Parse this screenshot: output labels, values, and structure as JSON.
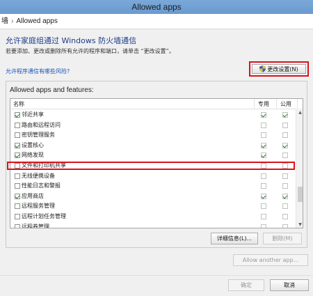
{
  "window": {
    "title": "Allowed apps"
  },
  "breadcrumb": {
    "prefix": "墙",
    "separator": "›",
    "current": "Allowed apps"
  },
  "header": {
    "title": "允许家庭组通过 Windows 防火墙通信",
    "description": "若要添加、更改或删除所有允许的程序和端口，请单击 “更改设置”。",
    "risk_link": "允许程序通信有哪些风险?",
    "change_settings_label": "更改设置(N)"
  },
  "list": {
    "group_label": "Allowed apps and features:",
    "columns": {
      "name": "名称",
      "private": "专用",
      "public": "公用"
    },
    "rows": [
      {
        "label": "邻近共享",
        "enabled": true,
        "private": true,
        "public": true
      },
      {
        "label": "路由和远程访问",
        "enabled": false,
        "private": false,
        "public": false
      },
      {
        "label": "密钥管理服务",
        "enabled": false,
        "private": false,
        "public": false
      },
      {
        "label": "设置核心",
        "enabled": true,
        "private": true,
        "public": true
      },
      {
        "label": "网络发现",
        "enabled": true,
        "private": true,
        "public": false
      },
      {
        "label": "文件和打印机共享",
        "enabled": false,
        "private": false,
        "public": false
      },
      {
        "label": "无线便携设备",
        "enabled": false,
        "private": false,
        "public": false
      },
      {
        "label": "性能日志和警报",
        "enabled": false,
        "private": false,
        "public": false
      },
      {
        "label": "应用商店",
        "enabled": true,
        "private": true,
        "public": true
      },
      {
        "label": "远程服务管理",
        "enabled": false,
        "private": false,
        "public": false
      },
      {
        "label": "远程计划任务管理",
        "enabled": false,
        "private": false,
        "public": false
      },
      {
        "label": "远程卷管理",
        "enabled": false,
        "private": false,
        "public": false
      }
    ]
  },
  "buttons": {
    "details": "详细信息(L)...",
    "remove": "删除(M)",
    "allow_another": "Allow another app...",
    "ok": "确定",
    "cancel": "取消"
  }
}
